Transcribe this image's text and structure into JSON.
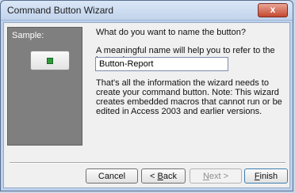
{
  "window": {
    "title": "Command Button Wizard",
    "close_glyph": "x"
  },
  "sample": {
    "label": "Sample:"
  },
  "main": {
    "question": "What do you want to name the button?",
    "hint": "A meaningful name will help you to refer to the button later.",
    "name_value": "Button-Report",
    "info_text": "That's all the information the wizard needs to create your command button. Note: This wizard creates embedded macros that cannot run or be edited in Access 2003 and earlier versions."
  },
  "buttons": {
    "cancel": "Cancel",
    "back_arrow": "< ",
    "back_underlined": "B",
    "back_rest": "ack",
    "next_underlined": "N",
    "next_rest": "ext >",
    "finish_underlined": "F",
    "finish_rest": "inish"
  }
}
